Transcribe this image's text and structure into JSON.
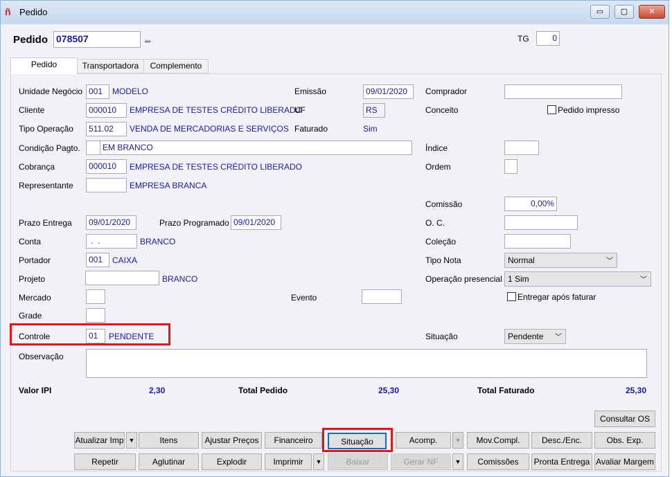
{
  "window": {
    "title": "Pedido",
    "minimize": "▭",
    "maximize": "▢",
    "close": "✕"
  },
  "header": {
    "pedido_label": "Pedido",
    "pedido_value": "078507",
    "lookup": "...",
    "tg_label": "TG",
    "tg_value": "0"
  },
  "tabs": [
    "Pedido",
    "Transportadora",
    "Complemento"
  ],
  "form": {
    "unidade_label": "Unidade Negócio",
    "unidade_code": "001",
    "unidade_name": "MODELO",
    "emissao_label": "Emissão",
    "emissao_value": "09/01/2020",
    "comprador_label": "Comprador",
    "comprador_value": "",
    "cliente_label": "Cliente",
    "cliente_code": "000010",
    "cliente_name": "EMPRESA DE TESTES CRÉDITO LIBERADC",
    "uf_label": "UF",
    "uf_value": "RS",
    "conceito_label": "Conceito",
    "pedido_impresso_label": "Pedido impresso",
    "tipo_op_label": "Tipo Operação",
    "tipo_op_code": "511.02",
    "tipo_op_name": "VENDA DE MERCADORIAS E SERVIÇOS",
    "faturado_label": "Faturado",
    "faturado_value": "Sim",
    "cond_label": "Condição Pagto.",
    "cond_code": "",
    "cond_name": "EM BRANCO",
    "indice_label": "Índice",
    "indice_value": "",
    "cobranca_label": "Cobrança",
    "cobranca_code": "000010",
    "cobranca_name": "EMPRESA DE TESTES CRÉDITO LIBERADO",
    "ordem_label": "Ordem",
    "ordem_value": "",
    "rep_label": "Representante",
    "rep_code": "",
    "rep_name": "EMPRESA BRANCA",
    "comissao_label": "Comissão",
    "comissao_value": "0,00%",
    "prazo_label": "Prazo Entrega",
    "prazo_value": "09/01/2020",
    "prazo_prog_label": "Prazo Programado",
    "prazo_prog_value": "09/01/2020",
    "oc_label": "O. C.",
    "oc_value": "",
    "conta_label": "Conta",
    "conta_value": " .  .",
    "conta_name": "BRANCO",
    "colecao_label": "Coleção",
    "colecao_value": "",
    "portador_label": "Portador",
    "portador_code": "001",
    "portador_name": "CAIXA",
    "tipo_nota_label": "Tipo Nota",
    "tipo_nota_value": "Normal",
    "projeto_label": "Projeto",
    "projeto_value": "",
    "projeto_name": "BRANCO",
    "op_presencial_label": "Operação presencial",
    "op_presencial_value": "1 Sim",
    "mercado_label": "Mercado",
    "evento_label": "Evento",
    "entregar_label": "Entregar após faturar",
    "grade_label": "Grade",
    "controle_label": "Controle",
    "controle_code": "01",
    "controle_name": "PENDENTE",
    "situacao_label": "Situação",
    "situacao_value": "Pendente",
    "obs_label": "Observação",
    "obs_value": ""
  },
  "totals": {
    "ipi_label": "Valor IPI",
    "ipi_value": "2,30",
    "pedido_label": "Total Pedido",
    "pedido_value": "25,30",
    "faturado_label": "Total Faturado",
    "faturado_value": "25,30"
  },
  "buttons": {
    "consultar_os": "Consultar OS",
    "atualizar_imp": "Atualizar Imp",
    "itens": "Itens",
    "ajustar_precos": "Ajustar Preços",
    "financeiro": "Financeiro",
    "situacao": "Situação",
    "acomp": "Acomp.",
    "mov_compl": "Mov.Compl.",
    "desc_enc": "Desc./Enc.",
    "obs_exp": "Obs. Exp.",
    "repetir": "Repetir",
    "aglutinar": "Aglutinar",
    "explodir": "Explodir",
    "imprimir": "Imprimir",
    "baixar": "Baixar",
    "gerar_nf": "Gerar NF",
    "comissoes": "Comissões",
    "pronta_entrega": "Pronta Entrega",
    "avaliar_margem": "Avaliar Margem"
  },
  "colors": {
    "accent_text": "#1a1aa8",
    "highlight": "#e8141c"
  }
}
